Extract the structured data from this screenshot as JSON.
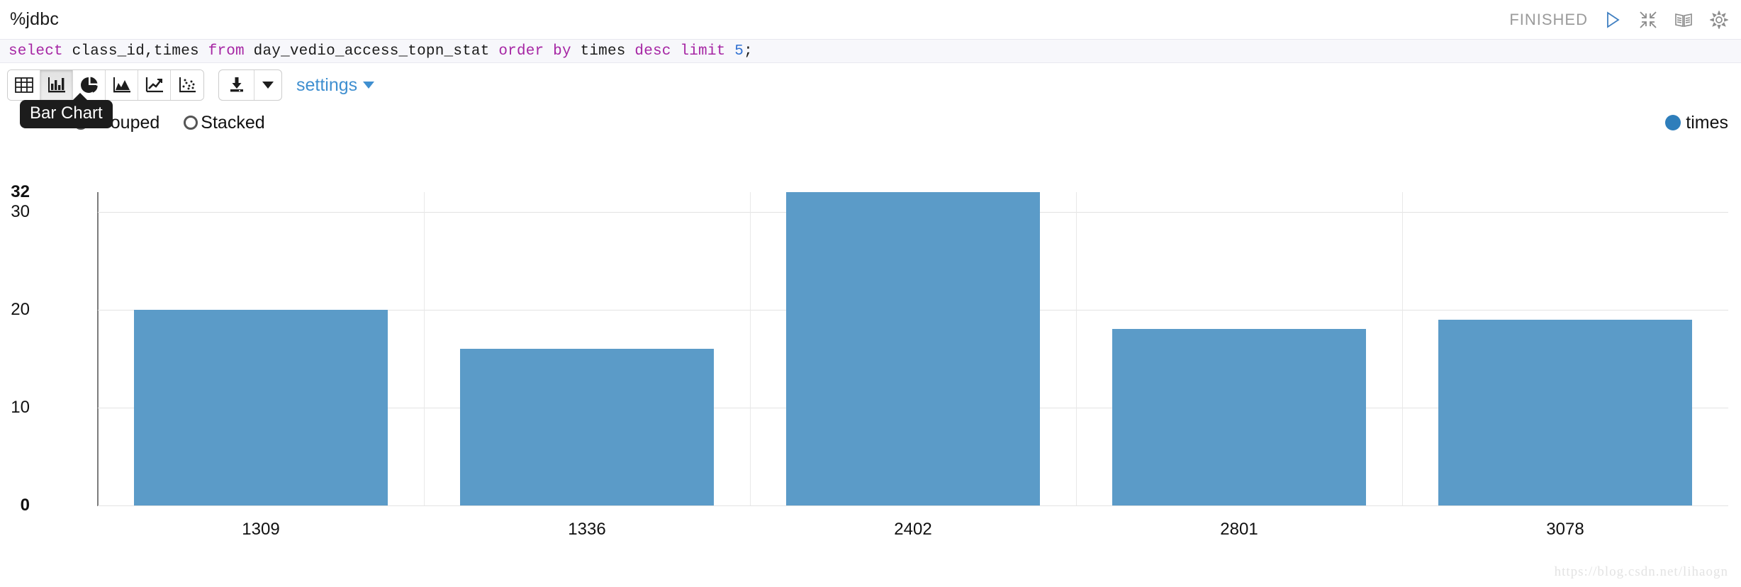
{
  "header": {
    "title": "%jdbc",
    "status": "FINISHED",
    "icons": [
      "run-icon",
      "collapse-icon",
      "book-icon",
      "gear-icon"
    ]
  },
  "editor": {
    "code_plain": "select class_id,times from day_vedio_access_topn_stat order by times desc limit 5;",
    "tokens": [
      {
        "t": "select",
        "type": "keyword"
      },
      {
        "t": " class_id,times ",
        "type": "plain"
      },
      {
        "t": "from",
        "type": "keyword"
      },
      {
        "t": " day_vedio_access_topn_stat ",
        "type": "plain"
      },
      {
        "t": "order",
        "type": "keyword"
      },
      {
        "t": " ",
        "type": "plain"
      },
      {
        "t": "by",
        "type": "keyword"
      },
      {
        "t": " times ",
        "type": "plain"
      },
      {
        "t": "desc",
        "type": "keyword"
      },
      {
        "t": " ",
        "type": "plain"
      },
      {
        "t": "limit",
        "type": "keyword"
      },
      {
        "t": " ",
        "type": "plain"
      },
      {
        "t": "5",
        "type": "number"
      },
      {
        "t": ";",
        "type": "plain"
      }
    ]
  },
  "toolbar": {
    "viz_buttons": [
      {
        "name": "table-icon",
        "label": "Table",
        "active": false
      },
      {
        "name": "bar-chart-icon",
        "label": "Bar Chart",
        "active": true
      },
      {
        "name": "pie-chart-icon",
        "label": "Pie Chart",
        "active": false
      },
      {
        "name": "area-chart-icon",
        "label": "Area Chart",
        "active": false
      },
      {
        "name": "line-chart-icon",
        "label": "Line Chart",
        "active": false
      },
      {
        "name": "scatter-chart-icon",
        "label": "Scatter Chart",
        "active": false
      }
    ],
    "download_icon": "download-icon",
    "download_caret": "chevron-down-icon",
    "settings_label": "settings"
  },
  "options": {
    "tooltip": "Bar Chart",
    "radios": [
      {
        "label": "Grouped",
        "checked": true
      },
      {
        "label": "Stacked",
        "checked": false
      }
    ]
  },
  "legend": {
    "series_label": "times",
    "color": "#2e7ebb"
  },
  "watermark": "https://blog.csdn.net/lihaogn",
  "colors": {
    "bar": "#5b9bc8",
    "accent": "#3f8fd0",
    "status": "#9b9b9b"
  },
  "chart_data": {
    "type": "bar",
    "title": "",
    "xlabel": "",
    "ylabel": "",
    "categories": [
      "1309",
      "1336",
      "2402",
      "2801",
      "3078"
    ],
    "series": [
      {
        "name": "times",
        "values": [
          20,
          16,
          32,
          18,
          19
        ],
        "color": "#5b9bc8"
      }
    ],
    "yticks": [
      {
        "value": 32,
        "label": "32",
        "bold": true,
        "gridline": false
      },
      {
        "value": 30,
        "label": "30",
        "bold": false,
        "gridline": true
      },
      {
        "value": 20,
        "label": "20",
        "bold": false,
        "gridline": true
      },
      {
        "value": 10,
        "label": "10",
        "bold": false,
        "gridline": true
      },
      {
        "value": 0,
        "label": "0",
        "bold": true,
        "gridline": true
      }
    ],
    "ylim": [
      0,
      32
    ],
    "grid": true,
    "legend_position": "top-right",
    "mode": "Grouped"
  }
}
